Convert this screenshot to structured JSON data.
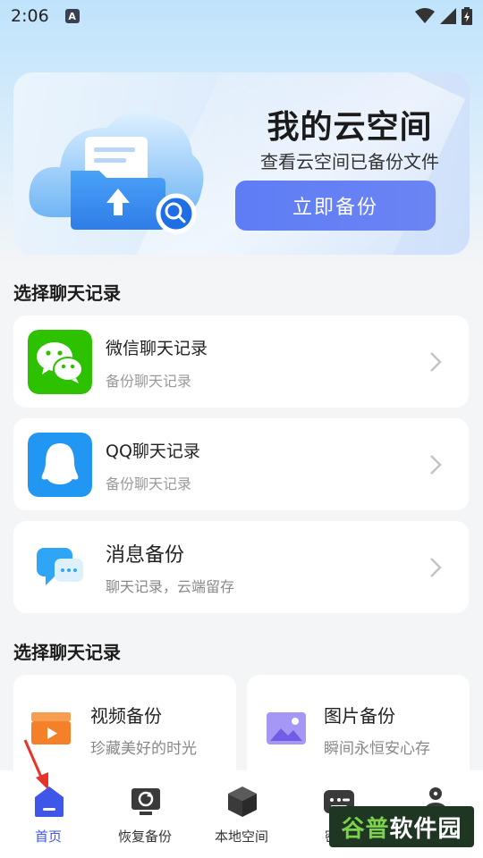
{
  "status_bar": {
    "time": "2:06",
    "badge": "A"
  },
  "banner": {
    "title": "我的云空间",
    "subtitle": "查看云空间已备份文件",
    "button_label": "立即备份"
  },
  "section1": {
    "title": "选择聊天记录",
    "items": [
      {
        "title": "微信聊天记录",
        "subtitle": "备份聊天记录",
        "icon": "wechat-icon",
        "color": "#2dc100"
      },
      {
        "title": "QQ聊天记录",
        "subtitle": "备份聊天记录",
        "icon": "qq-icon",
        "color": "#2196f3"
      },
      {
        "title": "消息备份",
        "subtitle": "聊天记录，云端留存",
        "icon": "message-icon",
        "color": "#2fa6f5"
      }
    ]
  },
  "section2": {
    "title": "选择聊天记录",
    "items": [
      {
        "title": "视频备份",
        "subtitle": "珍藏美好的时光",
        "icon": "video-icon",
        "color": "#f5802a"
      },
      {
        "title": "图片备份",
        "subtitle": "瞬间永恒安心存",
        "icon": "image-icon",
        "color": "#8d7cf2"
      }
    ]
  },
  "bottom_nav": {
    "items": [
      {
        "label": "首页",
        "icon": "home-icon",
        "active": true
      },
      {
        "label": "恢复备份",
        "icon": "restore-icon",
        "active": false
      },
      {
        "label": "本地空间",
        "icon": "box-icon",
        "active": false
      },
      {
        "label": "密码",
        "icon": "password-icon",
        "active": false
      },
      {
        "label": "",
        "icon": "profile-icon",
        "active": false
      }
    ]
  },
  "watermark": {
    "part1": "谷普",
    "part2": "软件园"
  },
  "colors": {
    "accent": "#3f57e8",
    "button": "#5e7df5"
  }
}
